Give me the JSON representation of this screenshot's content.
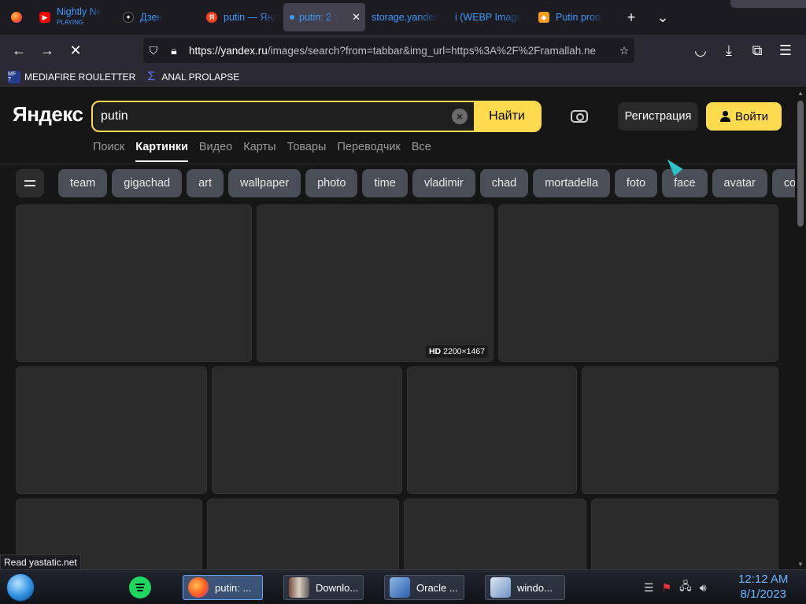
{
  "browser": {
    "tabs": [
      {
        "label": "Nightly Ne",
        "sub": "PLAYING",
        "icon": "youtube-icon"
      },
      {
        "label": "Дзен",
        "icon": "dzen-icon"
      },
      {
        "label": "putin — Янд",
        "icon": "yandex-icon"
      },
      {
        "label": "putin: 2 т",
        "icon": "loading-dot-icon",
        "active": true
      },
      {
        "label": "storage.yandex",
        "icon": ""
      },
      {
        "label": "i (WEBP Image",
        "icon": ""
      },
      {
        "label": "Putin prom",
        "icon": "pm-icon"
      }
    ],
    "new_tab": "+",
    "tab_list": "⌄",
    "url_host": "https://yandex.ru",
    "url_rest": "/images/search?from=tabbar&img_url=https%3A%2F%2Framallah.ne",
    "bookmarks": [
      {
        "label": "MEDIAFIRE ROULETTER",
        "icon_text": "MF T"
      },
      {
        "label": "ANAL PROLAPSE",
        "icon_text": "Σ"
      }
    ]
  },
  "yandex": {
    "logo": "Яндекс",
    "search_value": "putin",
    "search_button": "Найти",
    "register": "Регистрация",
    "login": "Войти",
    "services": [
      "Поиск",
      "Картинки",
      "Видео",
      "Карты",
      "Товары",
      "Переводчик",
      "Все"
    ],
    "active_service": "Картинки",
    "chips": [
      "team",
      "gigachad",
      "art",
      "wallpaper",
      "photo",
      "time",
      "vladimir",
      "chad",
      "mortadella",
      "foto",
      "face",
      "avatar",
      "co"
    ],
    "badge_hd": "HD",
    "badge_size": "2200×1467"
  },
  "status_text": "Read yastatic.net",
  "taskbar": {
    "buttons": [
      "putin: ...",
      "Downlo...",
      "Oracle ...",
      "windo..."
    ],
    "time": "12:12 AM",
    "date": "8/1/2023"
  },
  "colors": {
    "accent_yellow": "#ffdb4d",
    "link_blue": "#3b9bff",
    "chip_bg": "#4a4f57"
  }
}
